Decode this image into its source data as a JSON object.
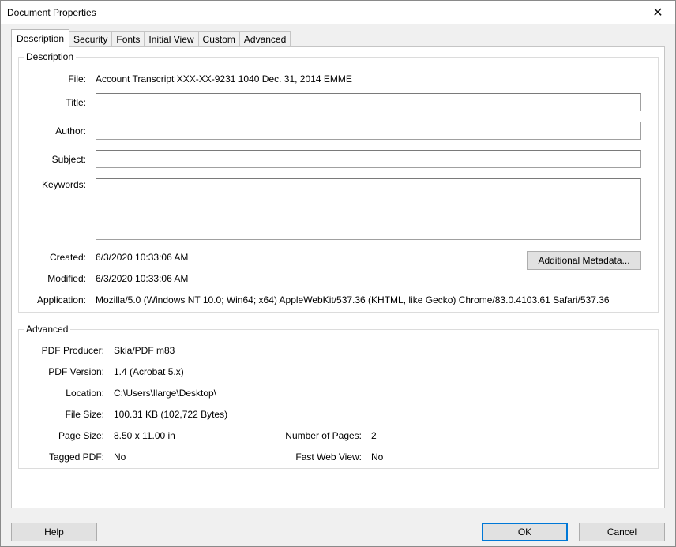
{
  "window": {
    "title": "Document Properties",
    "close_glyph": "✕"
  },
  "tabs": [
    {
      "label": "Description"
    },
    {
      "label": "Security"
    },
    {
      "label": "Fonts"
    },
    {
      "label": "Initial View"
    },
    {
      "label": "Custom"
    },
    {
      "label": "Advanced"
    }
  ],
  "description": {
    "legend": "Description",
    "file_label": "File:",
    "file_value": "Account Transcript XXX-XX-9231 1040 Dec. 31, 2014 EMME",
    "title_label": "Title:",
    "title_value": "",
    "author_label": "Author:",
    "author_value": "",
    "subject_label": "Subject:",
    "subject_value": "",
    "keywords_label": "Keywords:",
    "keywords_value": "",
    "created_label": "Created:",
    "created_value": "6/3/2020 10:33:06 AM",
    "modified_label": "Modified:",
    "modified_value": "6/3/2020 10:33:06 AM",
    "application_label": "Application:",
    "application_value": "Mozilla/5.0 (Windows NT 10.0; Win64; x64) AppleWebKit/537.36 (KHTML, like Gecko) Chrome/83.0.4103.61 Safari/537.36",
    "metadata_button": "Additional Metadata..."
  },
  "advanced": {
    "legend": "Advanced",
    "producer_label": "PDF Producer:",
    "producer_value": "Skia/PDF m83",
    "version_label": "PDF Version:",
    "version_value": "1.4 (Acrobat 5.x)",
    "location_label": "Location:",
    "location_value": "C:\\Users\\llarge\\Desktop\\",
    "filesize_label": "File Size:",
    "filesize_value": "100.31 KB (102,722 Bytes)",
    "pagesize_label": "Page Size:",
    "pagesize_value": "8.50 x 11.00 in",
    "numpages_label": "Number of Pages:",
    "numpages_value": "2",
    "tagged_label": "Tagged PDF:",
    "tagged_value": "No",
    "fastweb_label": "Fast Web View:",
    "fastweb_value": "No"
  },
  "footer": {
    "help": "Help",
    "ok": "OK",
    "cancel": "Cancel"
  }
}
